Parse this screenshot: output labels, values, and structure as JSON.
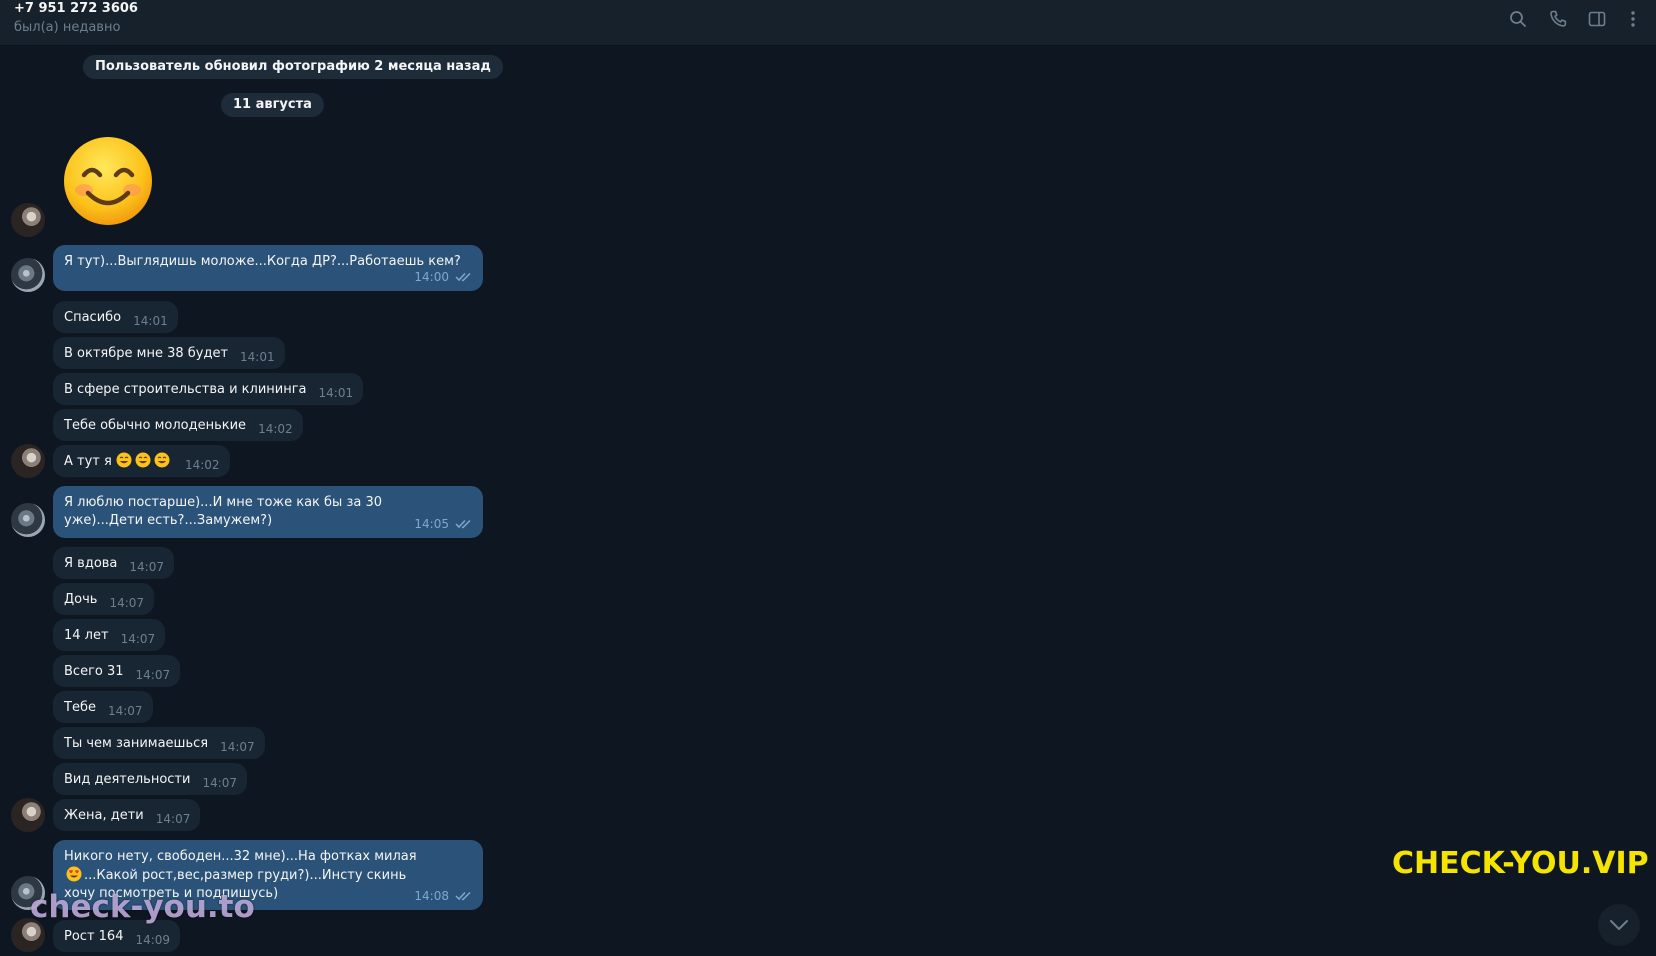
{
  "header": {
    "title": "+7 951 272 3606",
    "status": "был(а) недавно",
    "icons": [
      "search-icon",
      "phone-icon",
      "sidebar-toggle-icon",
      "more-vert-icon"
    ]
  },
  "service": {
    "photo_update": "Пользователь обновил фотографию 2 месяца назад",
    "date": "11 августа"
  },
  "messages": [
    {
      "dir": "in",
      "text": "",
      "time": "",
      "sticker": "smiling-emoji"
    },
    {
      "dir": "out",
      "text": "Я тут)...Выглядишь моложе...Когда ДР?...Работаешь кем?",
      "time": "14:00"
    },
    {
      "dir": "in",
      "text": "Спасибо",
      "time": "14:01"
    },
    {
      "dir": "in",
      "text": "В октябре мне 38 будет",
      "time": "14:01"
    },
    {
      "dir": "in",
      "text": "В сфере строительства и клининга",
      "time": "14:01"
    },
    {
      "dir": "in",
      "text": "Тебе обычно молоденькие",
      "time": "14:02"
    },
    {
      "dir": "in",
      "text": "А тут я",
      "time": "14:02",
      "emoji_count": 3
    },
    {
      "dir": "out",
      "text": "Я люблю постарше)...И мне тоже как бы за 30 уже)...Дети есть?...Замужем?)",
      "time": "14:05"
    },
    {
      "dir": "in",
      "text": "Я вдова",
      "time": "14:07"
    },
    {
      "dir": "in",
      "text": "Дочь",
      "time": "14:07"
    },
    {
      "dir": "in",
      "text": "14 лет",
      "time": "14:07"
    },
    {
      "dir": "in",
      "text": "Всего 31",
      "time": "14:07"
    },
    {
      "dir": "in",
      "text": "Тебе",
      "time": "14:07"
    },
    {
      "dir": "in",
      "text": "Ты чем занимаешься",
      "time": "14:07"
    },
    {
      "dir": "in",
      "text": "Вид деятельности",
      "time": "14:07"
    },
    {
      "dir": "in",
      "text": "Жена, дети",
      "time": "14:07"
    },
    {
      "dir": "out",
      "text_before": "Никого нету, свободен...32 мне)...На фотках милая",
      "text_after": "...Какой рост,вес,размер груди?)...Инсту скинь хочу посмотреть и подпишусь)",
      "time": "14:08"
    },
    {
      "dir": "in",
      "text": "Рост 164",
      "time": "14:09"
    }
  ],
  "watermarks": {
    "right": "CHECK-YOU.VIP",
    "left": "check-you.to"
  },
  "colors": {
    "background": "#0e1621",
    "header": "#17212b",
    "incoming_bubble": "#182533",
    "outgoing_bubble": "#2b5278",
    "accent": "#5eb5f7",
    "watermark_yellow": "#f5e400"
  }
}
